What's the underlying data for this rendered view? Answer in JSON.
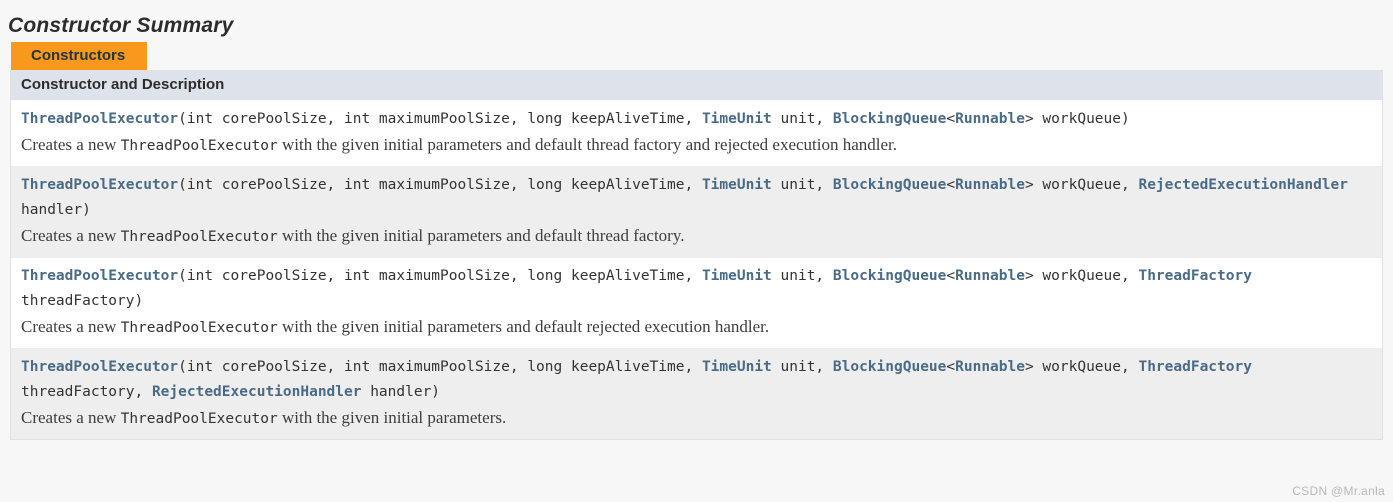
{
  "page": {
    "title": "Constructor Summary",
    "background_color": "#f7f7f7"
  },
  "table": {
    "caption": "Constructors",
    "caption_bg_color": "#f8981d",
    "column_header": "Constructor and Description",
    "column_header_bg_color": "#dee3e9",
    "link_color": "#4a6b87",
    "row_alt_bg_color": "#eeeeee",
    "rows": [
      {
        "signature_tokens": [
          {
            "text": "ThreadPoolExecutor",
            "kind": "ctor"
          },
          {
            "text": "(int corePoolSize, int maximumPoolSize, long keepAliveTime, ",
            "kind": "plain"
          },
          {
            "text": "TimeUnit",
            "kind": "link"
          },
          {
            "text": " unit, ",
            "kind": "plain"
          },
          {
            "text": "BlockingQueue",
            "kind": "link"
          },
          {
            "text": "<",
            "kind": "plain"
          },
          {
            "text": "Runnable",
            "kind": "link"
          },
          {
            "text": "> workQueue)",
            "kind": "plain"
          }
        ],
        "description_parts": [
          {
            "text": "Creates a new ",
            "kind": "text"
          },
          {
            "text": "ThreadPoolExecutor",
            "kind": "code"
          },
          {
            "text": " with the given initial parameters and default thread factory and rejected execution handler.",
            "kind": "text"
          }
        ]
      },
      {
        "signature_tokens": [
          {
            "text": "ThreadPoolExecutor",
            "kind": "ctor"
          },
          {
            "text": "(int corePoolSize, int maximumPoolSize, long keepAliveTime, ",
            "kind": "plain"
          },
          {
            "text": "TimeUnit",
            "kind": "link"
          },
          {
            "text": " unit, ",
            "kind": "plain"
          },
          {
            "text": "BlockingQueue",
            "kind": "link"
          },
          {
            "text": "<",
            "kind": "plain"
          },
          {
            "text": "Runnable",
            "kind": "link"
          },
          {
            "text": "> workQueue, ",
            "kind": "plain"
          },
          {
            "text": "RejectedExecutionHandler",
            "kind": "link"
          },
          {
            "text": " handler)",
            "kind": "plain"
          }
        ],
        "description_parts": [
          {
            "text": "Creates a new ",
            "kind": "text"
          },
          {
            "text": "ThreadPoolExecutor",
            "kind": "code"
          },
          {
            "text": " with the given initial parameters and default thread factory.",
            "kind": "text"
          }
        ]
      },
      {
        "signature_tokens": [
          {
            "text": "ThreadPoolExecutor",
            "kind": "ctor"
          },
          {
            "text": "(int corePoolSize, int maximumPoolSize, long keepAliveTime, ",
            "kind": "plain"
          },
          {
            "text": "TimeUnit",
            "kind": "link"
          },
          {
            "text": " unit, ",
            "kind": "plain"
          },
          {
            "text": "BlockingQueue",
            "kind": "link"
          },
          {
            "text": "<",
            "kind": "plain"
          },
          {
            "text": "Runnable",
            "kind": "link"
          },
          {
            "text": "> workQueue, ",
            "kind": "plain"
          },
          {
            "text": "ThreadFactory",
            "kind": "link"
          },
          {
            "text": " threadFactory)",
            "kind": "plain"
          }
        ],
        "description_parts": [
          {
            "text": "Creates a new ",
            "kind": "text"
          },
          {
            "text": "ThreadPoolExecutor",
            "kind": "code"
          },
          {
            "text": " with the given initial parameters and default rejected execution handler.",
            "kind": "text"
          }
        ]
      },
      {
        "signature_tokens": [
          {
            "text": "ThreadPoolExecutor",
            "kind": "ctor"
          },
          {
            "text": "(int corePoolSize, int maximumPoolSize, long keepAliveTime, ",
            "kind": "plain"
          },
          {
            "text": "TimeUnit",
            "kind": "link"
          },
          {
            "text": " unit, ",
            "kind": "plain"
          },
          {
            "text": "BlockingQueue",
            "kind": "link"
          },
          {
            "text": "<",
            "kind": "plain"
          },
          {
            "text": "Runnable",
            "kind": "link"
          },
          {
            "text": "> workQueue, ",
            "kind": "plain"
          },
          {
            "text": "ThreadFactory",
            "kind": "link"
          },
          {
            "text": " threadFactory, ",
            "kind": "plain"
          },
          {
            "text": "RejectedExecutionHandler",
            "kind": "link"
          },
          {
            "text": " handler)",
            "kind": "plain"
          }
        ],
        "description_parts": [
          {
            "text": "Creates a new ",
            "kind": "text"
          },
          {
            "text": "ThreadPoolExecutor",
            "kind": "code"
          },
          {
            "text": " with the given initial parameters.",
            "kind": "text"
          }
        ]
      }
    ]
  },
  "watermark": {
    "text": "CSDN @Mr.anla"
  }
}
